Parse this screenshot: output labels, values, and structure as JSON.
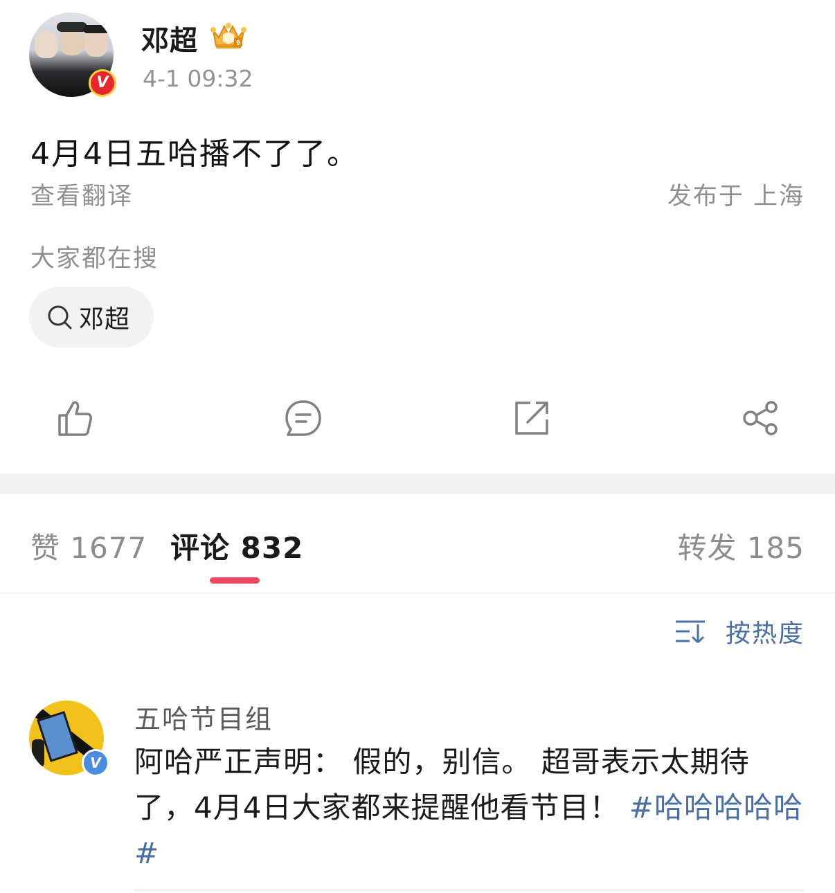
{
  "post": {
    "author": "邓超",
    "time": "4-1 09:32",
    "text": "4月4日五哈播不了了。",
    "translate_label": "查看翻译",
    "location": "发布于 上海",
    "search_section_label": "大家都在搜",
    "search_chip": "邓超",
    "verified_badge": "V"
  },
  "actions": [
    {
      "name": "like",
      "icon": "thumbs-up-icon"
    },
    {
      "name": "comment",
      "icon": "comment-bubble-icon"
    },
    {
      "name": "repost",
      "icon": "repost-external-icon"
    },
    {
      "name": "share",
      "icon": "share-icon"
    }
  ],
  "tabs": {
    "likes": "赞 1677",
    "comments": "评论 832",
    "reposts": "转发 185"
  },
  "sort": {
    "label": "按热度"
  },
  "comments": [
    {
      "author": "五哈节目组",
      "verified_badge": "V",
      "text": "阿哈严正声明： 假的，别信。 超哥表示太期待了，4月4日大家都来提醒他看节目！ ",
      "hashtag": "#哈哈哈哈哈#"
    }
  ],
  "colors": {
    "accent_tab_underline": "#f0475d",
    "link_blue": "#4a6fa5",
    "secondary_text": "#8f8f8f",
    "verified_red": "#e8262f",
    "verified_blue": "#4a8de0"
  }
}
